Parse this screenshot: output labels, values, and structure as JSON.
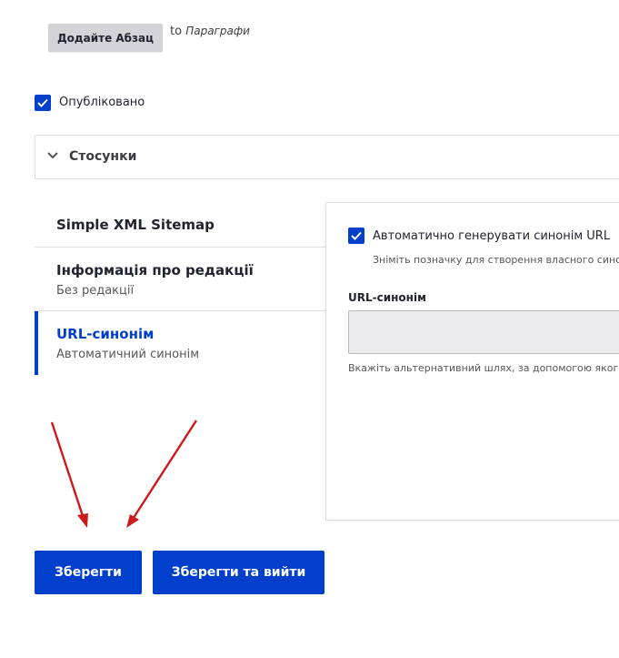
{
  "paragraphs": {
    "add_button_label": "Додайте Абзац",
    "to_prefix": "to",
    "to_target": "Параграфи"
  },
  "status": {
    "published_label": "Опубліковано",
    "published_checked": true
  },
  "relations": {
    "title": "Стосунки"
  },
  "vertical_tabs": [
    {
      "title": "Simple XML Sitemap",
      "summary": ""
    },
    {
      "title": "Інформація про редакції",
      "summary": "Без редакції"
    },
    {
      "title": "URL-синонім",
      "summary": "Автоматичний синонім",
      "active": true
    }
  ],
  "url_alias_pane": {
    "auto_label": "Автоматично генерувати синонім URL",
    "auto_checked": true,
    "auto_description": "Зніміть позначку для створення власного сино",
    "alias_label": "URL-синонім",
    "alias_value": "",
    "alias_description": "Вкажіть альтернативний шлях, за допомогою якого"
  },
  "actions": {
    "save_label": "Зберегти",
    "save_exit_label": "Зберегти та вийти"
  },
  "colors": {
    "accent": "#003ecc",
    "annotation_arrow": "#cc1a1a"
  }
}
